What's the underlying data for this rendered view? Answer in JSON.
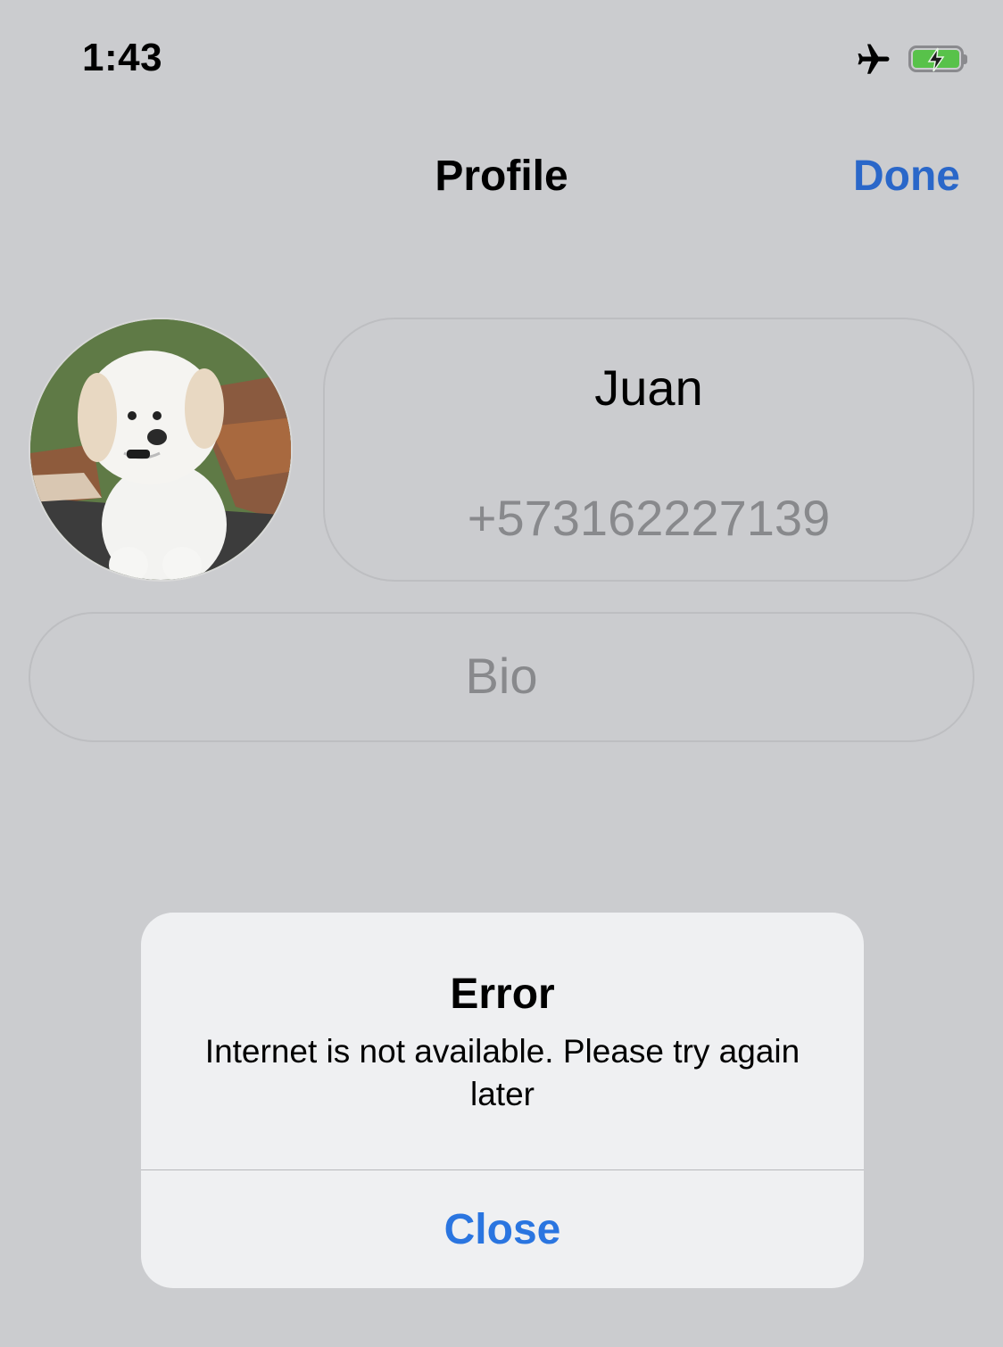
{
  "status_bar": {
    "time": "1:43",
    "icons": [
      "airplane-icon",
      "battery-charging-icon"
    ]
  },
  "nav": {
    "title": "Profile",
    "done_label": "Done"
  },
  "profile": {
    "avatar_icon": "dog-photo",
    "name": "Juan",
    "phone": "+573162227139",
    "bio_placeholder": "Bio"
  },
  "alert": {
    "title": "Error",
    "message": "Internet is not available. Please try again later",
    "close_label": "Close"
  },
  "colors": {
    "background": "#cbcccf",
    "accent": "#2a67c9",
    "alert_bg": "#eff0f2",
    "battery": "#58c24a"
  }
}
